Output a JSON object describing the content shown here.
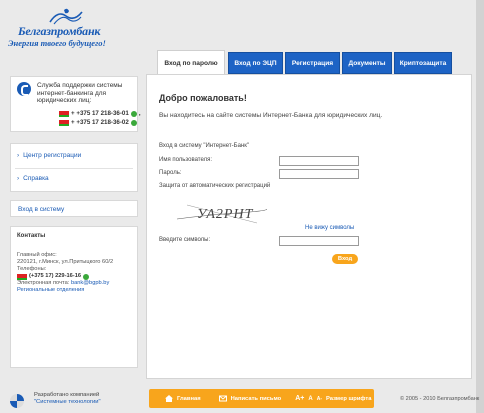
{
  "logo": {
    "name": "Белгазпромбанк",
    "slogan": "Энергия твоего будущего!"
  },
  "support": {
    "text": "Служба поддержки системы интернет-банкинга для юридических лиц:",
    "phone1": "+ +375 17 218-36-01",
    "phone2": "+ +375 17 218-36-02"
  },
  "sidebar": {
    "links": [
      {
        "label": "Центр регистрации"
      },
      {
        "label": "Справка"
      }
    ],
    "login_link": "Вход в систему"
  },
  "contacts": {
    "title": "Контакты",
    "office_label": "Главный офис:",
    "address": "220121, г.Минск, ул.Притыцкого 60/2",
    "phones_label": "Телефоны:",
    "phone": "(+375 17) 229-16-16",
    "email_label": "Электронная почта:",
    "email": "bank@bgpb.by",
    "branches": "Региональные отделения"
  },
  "tabs": [
    {
      "label": "Вход по паролю",
      "active": true
    },
    {
      "label": "Вход по ЭЦП",
      "active": false
    },
    {
      "label": "Регистрация",
      "active": false
    },
    {
      "label": "Документы",
      "active": false
    },
    {
      "label": "Криптозащита",
      "active": false
    }
  ],
  "main": {
    "welcome": "Добро пожаловать!",
    "intro": "Вы находитесь на сайте системы Интернет-Банка для юридических лиц.",
    "login_title": "Вход в систему \"Интернет-Банк\"",
    "username_label": "Имя пользователя:",
    "username_value": "",
    "password_label": "Пароль:",
    "password_value": "",
    "protection_label": "Защита от автоматических регистраций",
    "captcha_text": "УА2РНТ",
    "cant_see": "Не вижу символы",
    "enter_symbols_label": "Введите символы:",
    "symbols_value": "",
    "enter_button": "Вход"
  },
  "footer": {
    "developer_line1": "Разработано компанией",
    "developer_line2": "\"Системные технологии\"",
    "home": "Главная",
    "write_letter": "Написать письмо",
    "font_a1": "A+",
    "font_a2": "A",
    "font_a3": "A-",
    "font_size": "Размер шрифта",
    "copyright": "© 2005 - 2010 Белгазпромбанк"
  },
  "colors": {
    "accent_blue": "#1d63c5",
    "orange": "#f8a51c",
    "background": "#eaeaea"
  }
}
